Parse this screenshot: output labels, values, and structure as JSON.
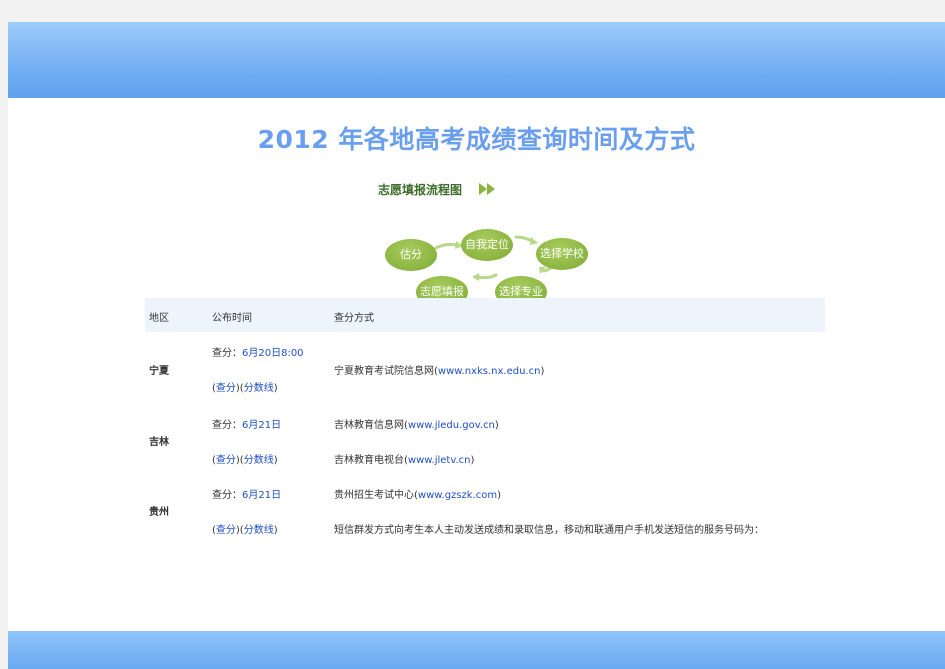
{
  "title": "2012 年各地高考成绩查询时间及方式",
  "flowchart": {
    "title": "志愿填报流程图",
    "steps": [
      "估分",
      "自我定位",
      "选择学校",
      "选择专业",
      "志愿填报"
    ]
  },
  "table": {
    "headers": [
      "地区",
      "公布时间",
      "查分方式"
    ],
    "rows": [
      {
        "region": "宁夏",
        "time_prefix": "查分：",
        "time": "6月20日8:00",
        "links": {
          "open": "(",
          "check": "查分",
          "mid": ")(",
          "score_line": "分数线",
          "close": ")"
        },
        "methods": [
          {
            "text": "宁夏教育考试院信息网(",
            "url": "www.nxks.nx.edu.cn",
            "close": ")"
          }
        ]
      },
      {
        "region": "吉林",
        "time_prefix": "查分：",
        "time": "6月21日",
        "links": {
          "open": "(",
          "check": "查分",
          "mid": ")(",
          "score_line": "分数线",
          "close": ")"
        },
        "methods": [
          {
            "text": "吉林教育信息网(",
            "url": "www.jledu.gov.cn",
            "close": ")"
          },
          {
            "text": "吉林教育电视台(",
            "url": "www.jletv.cn",
            "close": ")"
          }
        ]
      },
      {
        "region": "贵州",
        "time_prefix": "查分：",
        "time": "6月21日",
        "links": {
          "open": "(",
          "check": "查分",
          "mid": ")(",
          "score_line": "分数线",
          "close": ")"
        },
        "methods": [
          {
            "text": "贵州招生考试中心(",
            "url": "www.gzszk.com",
            "close": ")"
          },
          {
            "text": "短信群发方式向考生本人主动发送成绩和录取信息，移动和联通用户手机发送短信的服务号码为：",
            "url": "",
            "close": ""
          }
        ]
      }
    ]
  }
}
